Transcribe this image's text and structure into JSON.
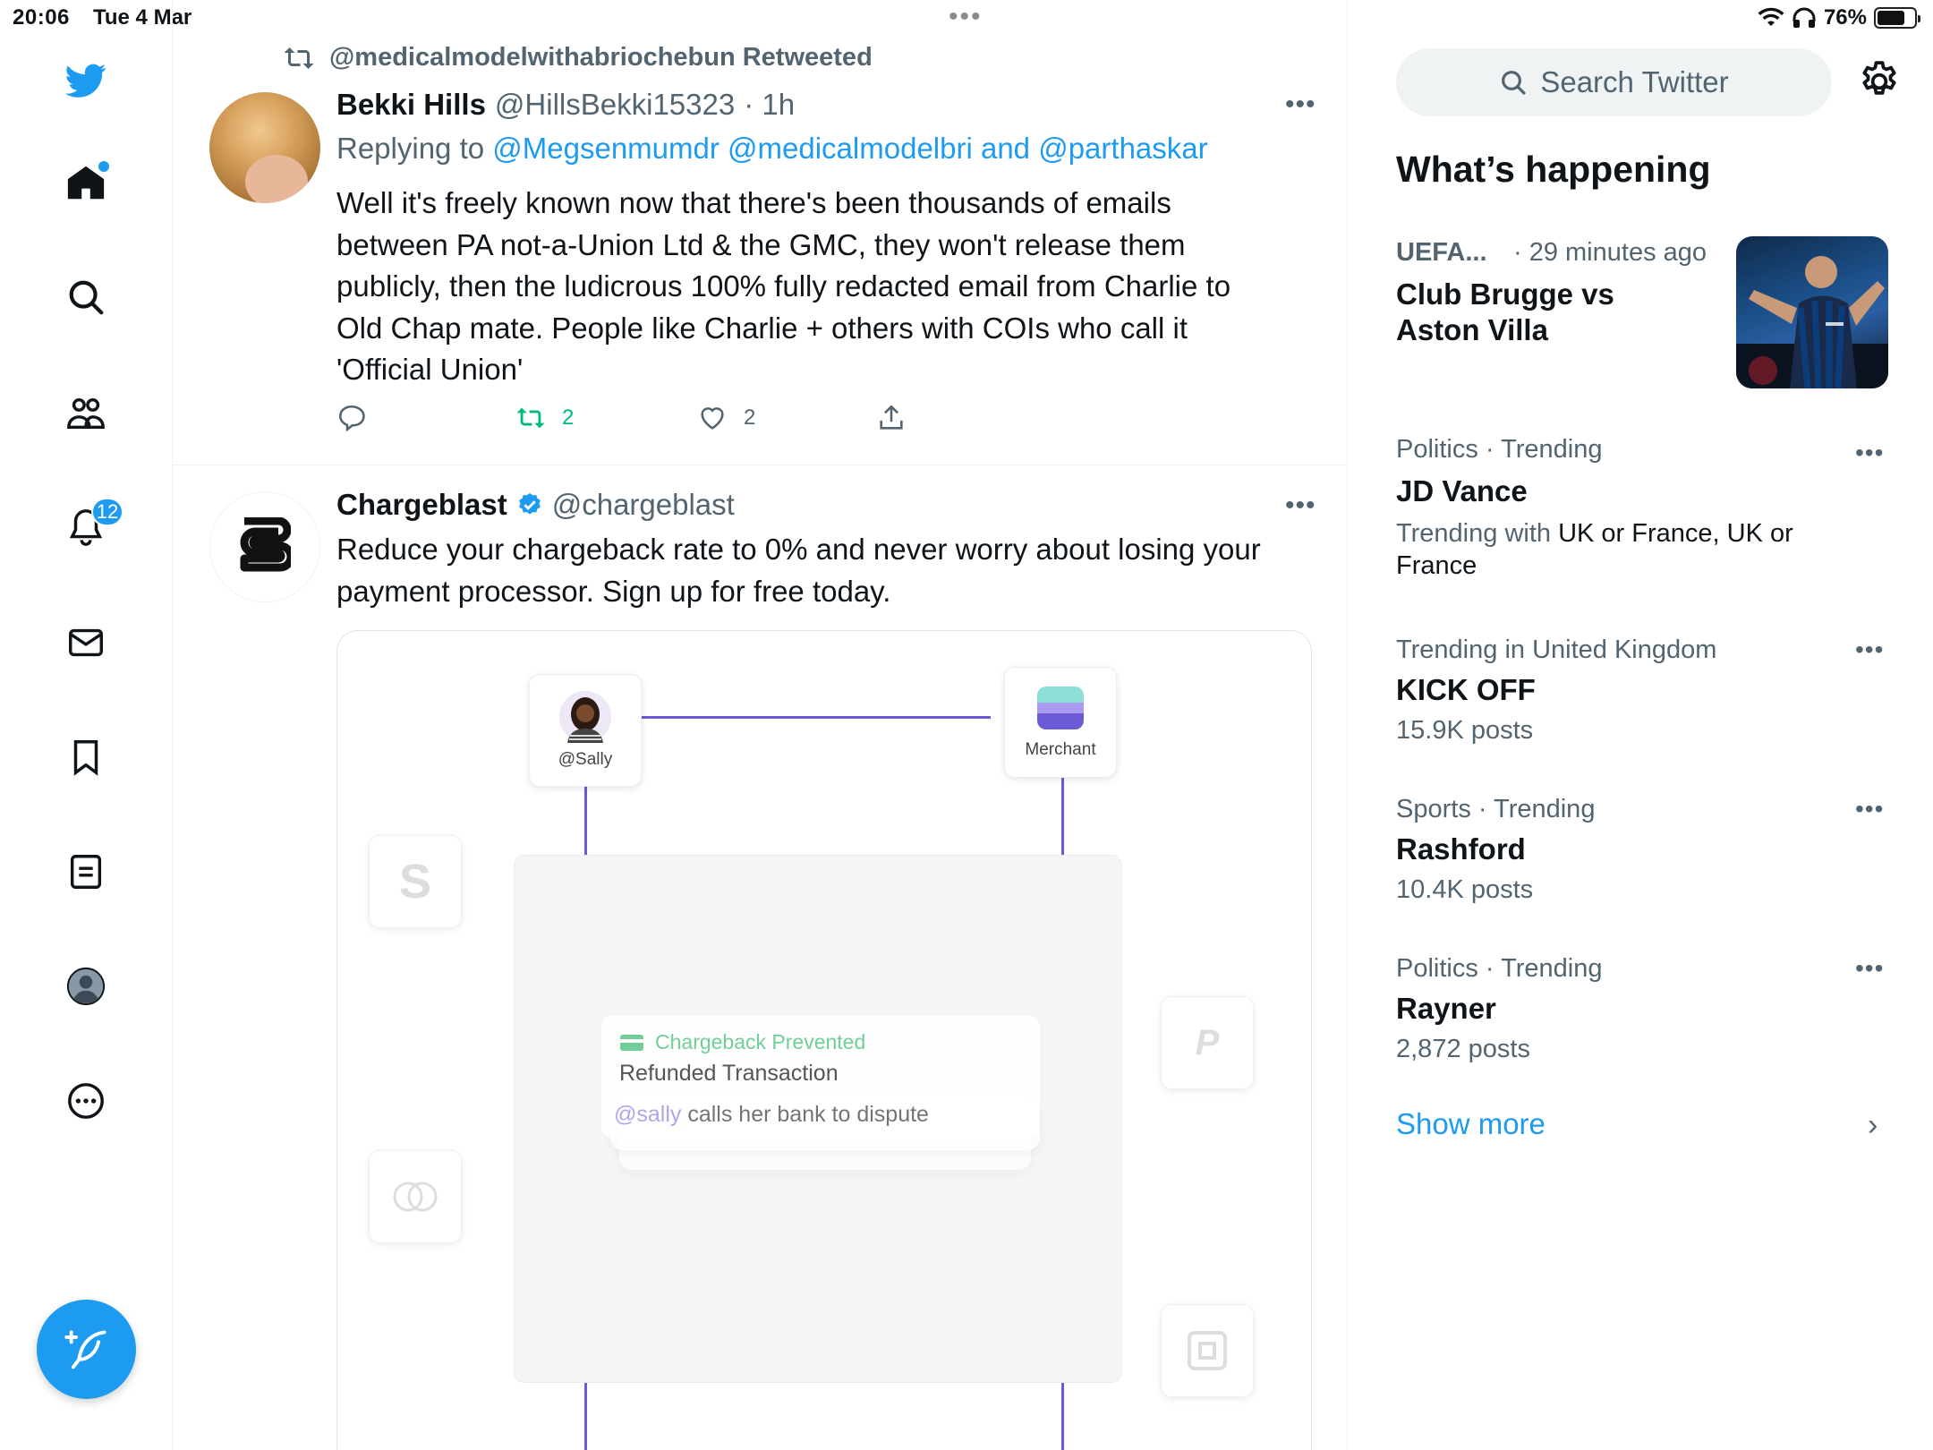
{
  "status_bar": {
    "time": "20:06",
    "date": "Tue 4 Mar",
    "battery": "76%",
    "battery_level": 0.76
  },
  "nav": {
    "notifications_count": "12"
  },
  "tweet1": {
    "retweeted_by": "@medicalmodelwithabriochebun Retweeted",
    "name": "Bekki Hills",
    "handle": "@HillsBekki15323",
    "time": "· 1h",
    "replying_prefix": "Replying to",
    "reply_to_1": "@Megsenmumdr",
    "reply_to_2": "@medicalmodelbri",
    "reply_and": "and",
    "reply_to_3": "@parthaskar",
    "text_lines": [
      "Well it's freely known now that there's been thousands of emails",
      "between PA not-a-Union Ltd & the GMC, they won't release them",
      "publicly, then the ludicrous 100% fully redacted email from Charlie to",
      "Old Chap mate. People like Charlie + others with COIs who call it",
      "'Official Union'"
    ],
    "retweets": "2",
    "likes": "2"
  },
  "tweet2": {
    "name": "Chargeblast",
    "handle": "@chargeblast",
    "text_lines": [
      "Reduce your chargeback rate to 0% and never worry about losing your",
      "payment processor. Sign up for free today."
    ],
    "card": {
      "sally_label": "@Sally",
      "merchant_label": "Merchant",
      "notif_title": "Chargeback Prevented",
      "notif_line": "Refunded Transaction",
      "notif_at": "@sally",
      "notif_tail": "calls her bank to dispute",
      "ghost_s": "S",
      "ghost_p": "P"
    }
  },
  "sidebar": {
    "search_placeholder": "Search Twitter",
    "whats_happening": "What’s happening",
    "news": {
      "category": "UEFA...",
      "time": "· 29 minutes ago",
      "title_1": "Club Brugge vs",
      "title_2": "Aston Villa"
    },
    "trends": [
      {
        "meta": "Politics · Trending",
        "title": "JD Vance",
        "sub_prefix": "Trending with",
        "sub_value_1": "UK or France, UK or",
        "sub_value_2": "France"
      },
      {
        "meta": "Trending in United Kingdom",
        "title": "KICK OFF",
        "posts": "15.9K posts"
      },
      {
        "meta": "Sports · Trending",
        "title": "Rashford",
        "posts": "10.4K posts"
      },
      {
        "meta": "Politics · Trending",
        "title": "Rayner",
        "posts": "2,872 posts"
      }
    ],
    "show_more": "Show more"
  },
  "colors": {
    "accent": "#1d9bf0",
    "retweet_green": "#00ba7c",
    "muted": "#536471",
    "card_line": "#6b5bd6"
  },
  "icons": [
    "twitter-logo-icon",
    "home-icon",
    "search-icon",
    "communities-icon",
    "bell-icon",
    "mail-icon",
    "bookmark-icon",
    "lists-icon",
    "profile-icon",
    "more-circle-icon",
    "compose-icon",
    "retweet-icon",
    "reply-icon",
    "like-icon",
    "share-icon",
    "verified-icon",
    "gear-icon",
    "chevron-right-icon"
  ]
}
